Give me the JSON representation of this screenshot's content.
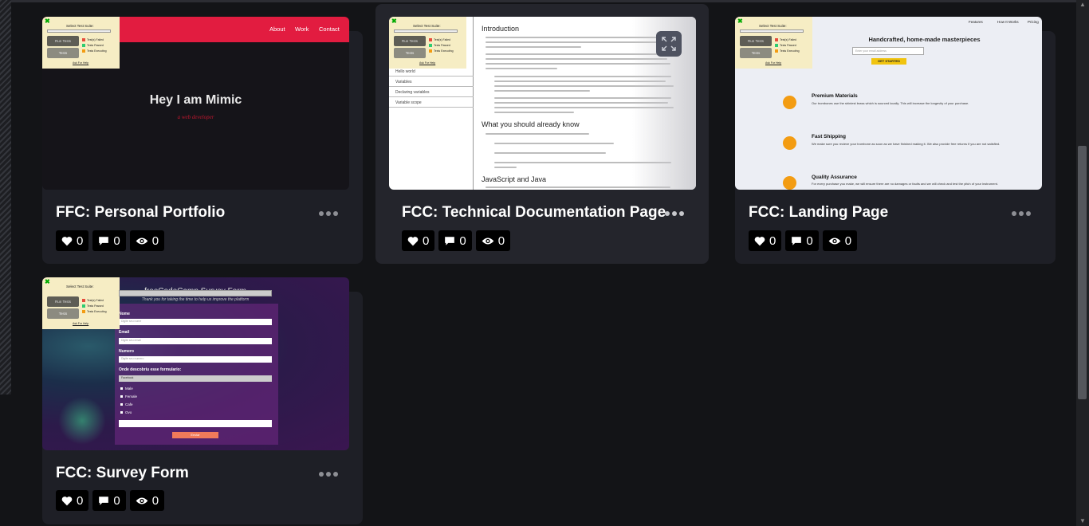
{
  "cards": [
    {
      "title": "FFC: Personal Portfolio",
      "likes": "0",
      "comments": "0",
      "views": "0",
      "preview": {
        "nav": [
          "About",
          "Work",
          "Contact"
        ],
        "hero": "Hey I am Mimic",
        "subtitle": "a web developer"
      }
    },
    {
      "title": "FCC: Technical Documentation Page",
      "likes": "0",
      "comments": "0",
      "views": "0",
      "preview": {
        "side_items": [
          "Hello world",
          "Variables",
          "Declaring variables",
          "Variable scope"
        ],
        "headings": [
          "Introduction",
          "What you should already know",
          "JavaScript and Java"
        ]
      }
    },
    {
      "title": "FCC: Landing Page",
      "likes": "0",
      "comments": "0",
      "views": "0",
      "preview": {
        "nav": [
          "Features",
          "How It Works",
          "Pricing"
        ],
        "headline": "Handcrafted, home-made masterpieces",
        "email_placeholder": "Enter your email address",
        "cta": "GET STARTED",
        "features": [
          {
            "title": "Premium Materials",
            "desc": "Our trombones use the shiniest brass which is sourced locally. This will increase the longevity of your purchase."
          },
          {
            "title": "Fast Shipping",
            "desc": "We make sure you recieve your trombone as soon as we have finished making it. We also provide free returns if you are not satisfied."
          },
          {
            "title": "Quality Assurance",
            "desc": "For every purchase you make, we will ensure there are no damages or faults and we will check and test the pitch of your instrument."
          }
        ]
      }
    },
    {
      "title": "FCC: Survey Form",
      "likes": "0",
      "comments": "0",
      "views": "0",
      "preview": {
        "heading": "freeCodeCamp Survey Form",
        "subheading": "Thank you for taking the time to help us improve the platform",
        "labels": [
          "Nome",
          "Email",
          "Numero",
          "Onde descobriu esse formulario:"
        ],
        "placeholders": [
          "Digite seu nome",
          "Digite seu email",
          "Digite seu numero"
        ],
        "select_value": "Facebook",
        "options": [
          "Male",
          "Female",
          "Cafe",
          "Ovo"
        ],
        "button": "Enviar"
      }
    }
  ],
  "test_suite": {
    "title": "Select Test Suite:",
    "run": "Run Tests",
    "tests": "Tests",
    "legend": [
      "Test(s) Failed",
      "Tests Passed",
      "Tests Executing"
    ],
    "help": "Ask For Help",
    "colors": {
      "failed": "#e74c3c",
      "passed": "#2ecc71",
      "executing": "#f39c12"
    }
  }
}
